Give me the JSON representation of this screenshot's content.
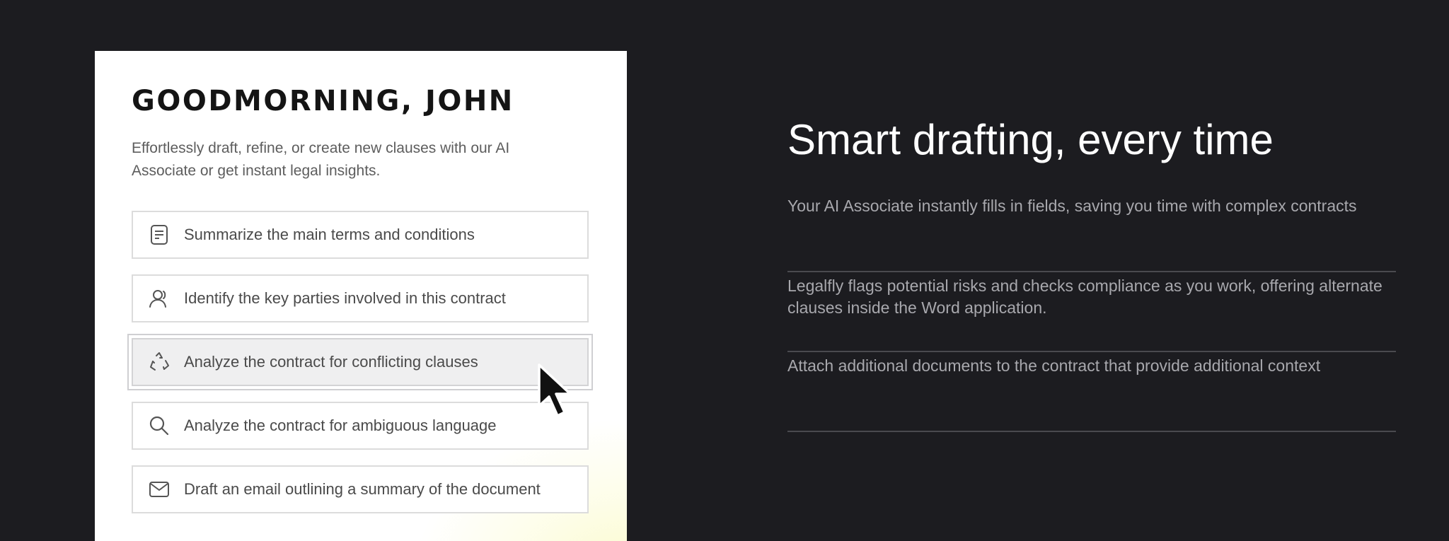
{
  "assistant": {
    "greeting": "GOODMORNING, JOHN",
    "intro": "Effortlessly draft, refine, or create new clauses with our AI Associate or get instant legal insights.",
    "prompts": [
      {
        "label": "Summarize the main terms and conditions",
        "icon": "document-icon"
      },
      {
        "label": "Identify the key parties involved in this contract",
        "icon": "user-icon"
      },
      {
        "label": "Analyze the contract for conflicting clauses",
        "icon": "recycle-icon",
        "state": "hovered"
      },
      {
        "label": "Analyze the contract for ambiguous language",
        "icon": "search-icon"
      },
      {
        "label": "Draft an email outlining a summary of the document",
        "icon": "mail-icon"
      }
    ]
  },
  "marketing": {
    "title": "Smart drafting, every time",
    "features": [
      "Your AI Associate instantly fills in fields, saving you time with complex contracts",
      "Legalfly flags potential risks and checks compliance as you work, offering alternate clauses inside the Word application.",
      "Attach additional documents to the contract that provide additional context"
    ]
  },
  "colors": {
    "background": "#1c1c20",
    "panel": "#ffffff",
    "highlight": "#efeff0",
    "accent_glow": "#fafabe"
  }
}
